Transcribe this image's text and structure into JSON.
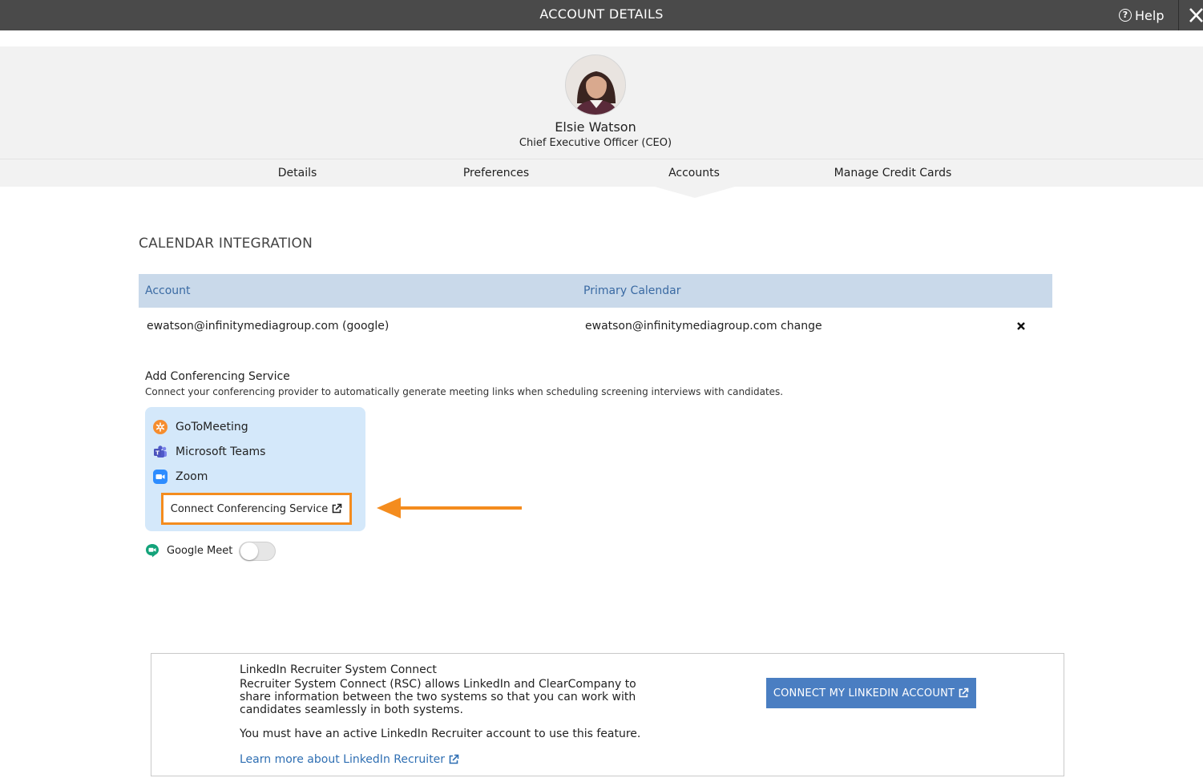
{
  "window": {
    "title": "ACCOUNT DETAILS",
    "help_label": "Help"
  },
  "profile": {
    "name": "Elsie Watson",
    "title": "Chief Executive Officer (CEO)"
  },
  "tabs": [
    {
      "label": "Details"
    },
    {
      "label": "Preferences"
    },
    {
      "label": "Accounts",
      "active": true
    },
    {
      "label": "Manage Credit Cards"
    }
  ],
  "calendar": {
    "heading": "CALENDAR INTEGRATION",
    "columns": [
      "Account",
      "Primary Calendar"
    ],
    "rows": [
      {
        "account": "ewatson@infinitymediagroup.com (google)",
        "primary": "ewatson@infinitymediagroup.com change"
      }
    ]
  },
  "conferencing": {
    "title": "Add Conferencing Service",
    "description": "Connect your conferencing provider to automatically generate meeting links when scheduling screening interviews with candidates.",
    "providers": [
      {
        "name": "GoToMeeting",
        "icon": "gotomeeting-icon",
        "color": "#f68d2e"
      },
      {
        "name": "Microsoft Teams",
        "icon": "teams-icon",
        "color": "#5059c9"
      },
      {
        "name": "Zoom",
        "icon": "zoom-icon",
        "color": "#2d8cff"
      }
    ],
    "connect_label": "Connect Conferencing Service",
    "google_meet_label": "Google Meet",
    "google_meet_enabled": false
  },
  "linkedin": {
    "title": "LinkedIn Recruiter System Connect",
    "description": "Recruiter System Connect (RSC) allows LinkedIn and ClearCompany to share information between the two systems so that you can work with candidates seamlessly in both systems.",
    "note": "You must have an active LinkedIn Recruiter account to use this feature.",
    "learn_more": "Learn more about LinkedIn Recruiter",
    "button_label": "CONNECT MY LINKEDIN ACCOUNT"
  },
  "colors": {
    "topbar": "#4a4a4a",
    "highlight": "#f48c1e",
    "table_header": "#c9d9ea",
    "link": "#2f6fb3",
    "button": "#4a7ec2"
  }
}
